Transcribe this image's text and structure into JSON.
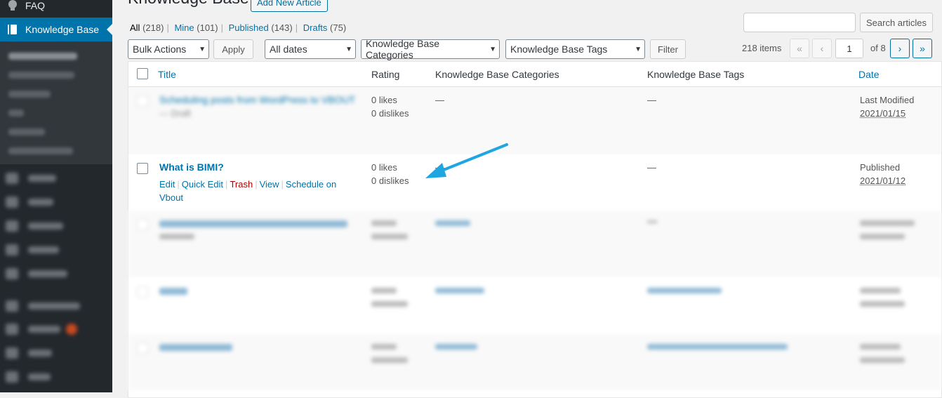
{
  "sidebar": {
    "faq_label": "FAQ",
    "kb_label": "Knowledge Base"
  },
  "header": {
    "title": "Knowledge Base",
    "add_new": "Add New Article"
  },
  "filters_links": [
    {
      "label": "All",
      "count": "(218)"
    },
    {
      "label": "Mine",
      "count": "(101)"
    },
    {
      "label": "Published",
      "count": "(143)"
    },
    {
      "label": "Drafts",
      "count": "(75)"
    }
  ],
  "search": {
    "button": "Search articles"
  },
  "toolbar": {
    "bulk_actions": "Bulk Actions",
    "apply": "Apply",
    "dates": "All dates",
    "categories": "Knowledge Base Categories",
    "tags": "Knowledge Base Tags",
    "filter": "Filter"
  },
  "pagination": {
    "items": "218 items",
    "first": "«",
    "prev": "‹",
    "current": "1",
    "of": "of 8",
    "next": "›",
    "last": "»"
  },
  "table": {
    "columns": [
      "Title",
      "Rating",
      "Knowledge Base Categories",
      "Knowledge Base Tags",
      "Date"
    ],
    "rows": [
      {
        "title": "Scheduling posts from WordPress to VBOUT",
        "state": "— Draft",
        "likes": "0 likes",
        "dislikes": "0 dislikes",
        "categories": "—",
        "tags": "—",
        "status": "Last Modified",
        "date": "2021/01/15"
      },
      {
        "title": "What is BIMI?",
        "likes": "0 likes",
        "dislikes": "0 dislikes",
        "categories": "—",
        "tags": "—",
        "status": "Published",
        "date": "2021/01/12",
        "actions": {
          "edit": "Edit",
          "quick_edit": "Quick Edit",
          "trash": "Trash",
          "view": "View",
          "schedule": "Schedule on",
          "schedule2": "Vbout"
        }
      }
    ]
  },
  "colors": {
    "accent": "#0073aa",
    "sidebar": "#23282d",
    "arrow": "#1ea6e3"
  }
}
